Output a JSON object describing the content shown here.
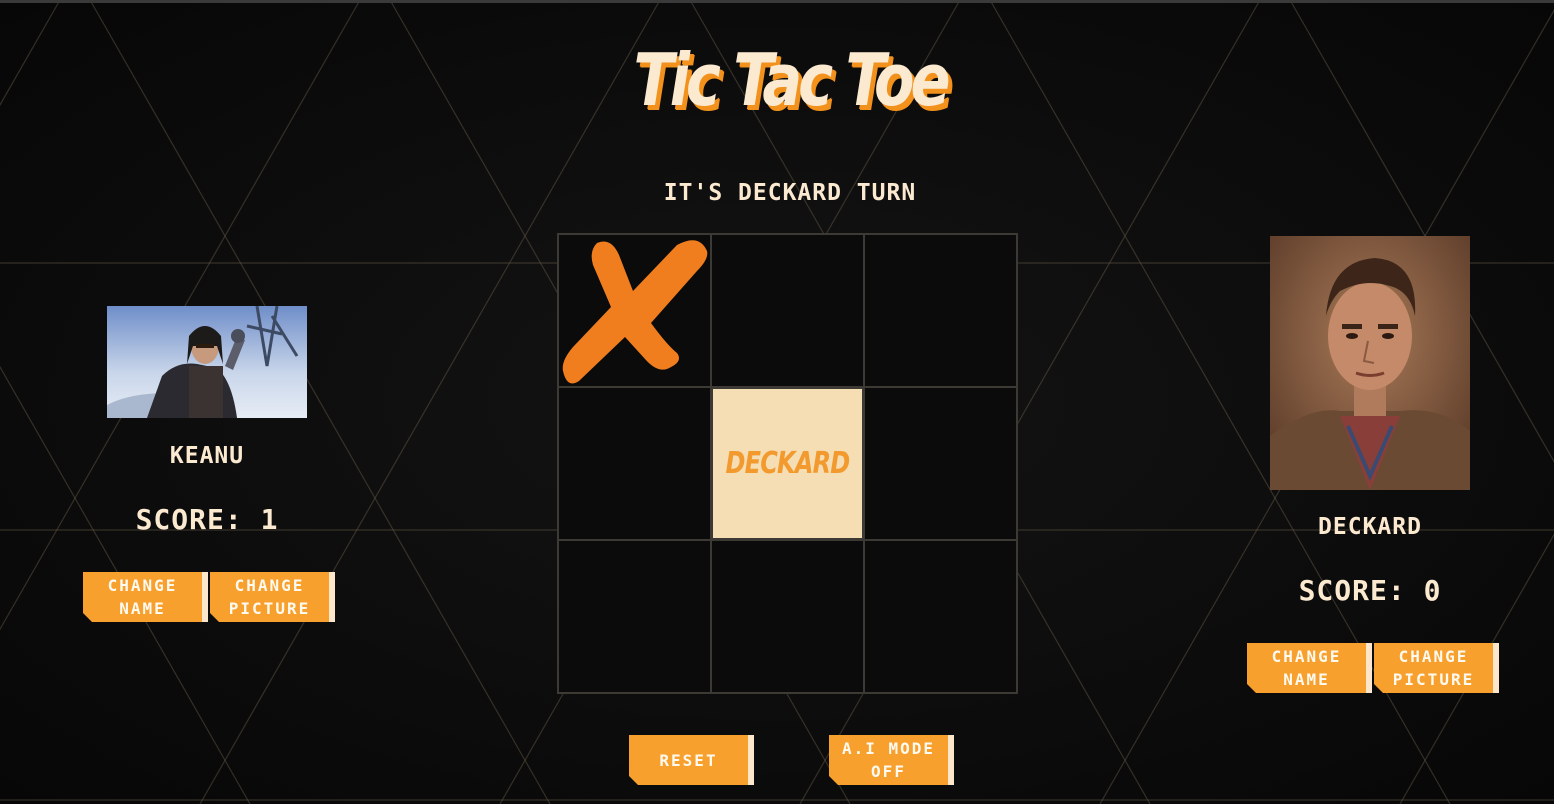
{
  "game": {
    "title": "Tic Tac Toe",
    "status": "IT'S DECKARD TURN"
  },
  "board": {
    "cells": [
      "X",
      "",
      "",
      "",
      "",
      "",
      "",
      "",
      ""
    ],
    "hover_cell_index": 4,
    "hover_label": "DECKARD"
  },
  "players": [
    {
      "name": "KEANU",
      "score": "SCORE: 1",
      "change_name_label": "CHANGE NAME",
      "change_picture_label": "CHANGE PICTURE"
    },
    {
      "name": "DECKARD",
      "score": "SCORE: 0",
      "change_name_label": "CHANGE NAME",
      "change_picture_label": "CHANGE PICTURE"
    }
  ],
  "controls": {
    "reset_label": "RESET",
    "ai_mode_label": "A.I MODE OFF"
  },
  "colors": {
    "accent": "#f7a02d",
    "mark_x": "#f07e1e",
    "text_cream": "#fbe9d0",
    "hover_cell": "#f5ddb4",
    "background": "#0c0c0c"
  }
}
